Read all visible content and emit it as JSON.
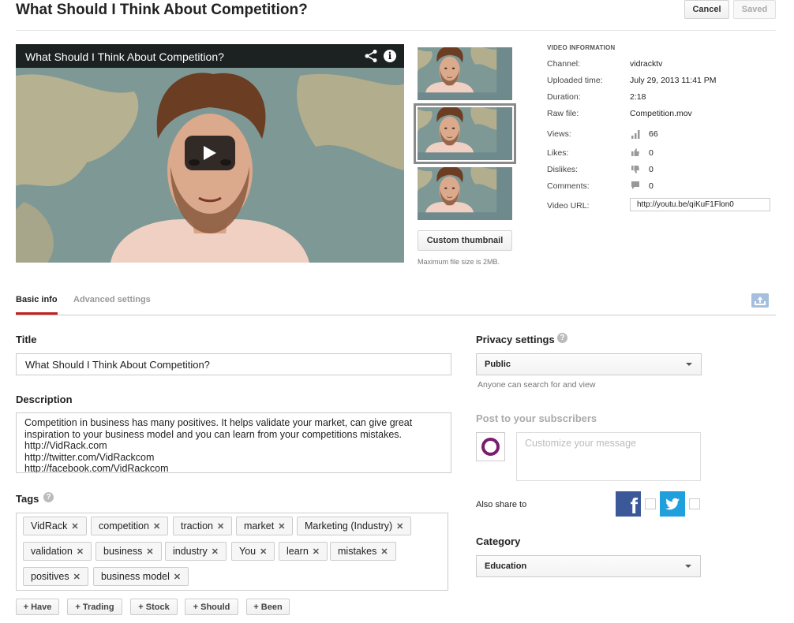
{
  "header": {
    "title": "What Should I Think About Competition?",
    "cancel_label": "Cancel",
    "saved_label": "Saved"
  },
  "player": {
    "title": "What Should I Think About Competition?",
    "icons": [
      "share-icon",
      "info-icon",
      "play-icon"
    ]
  },
  "thumbnails": {
    "selected_index": 1,
    "custom_label": "Custom thumbnail",
    "note": "Maximum file size is 2MB."
  },
  "video_info": {
    "heading": "VIDEO INFORMATION",
    "channel_label": "Channel:",
    "channel": "vidracktv",
    "uploaded_label": "Uploaded time:",
    "uploaded": "July 29, 2013 11:41 PM",
    "duration_label": "Duration:",
    "duration": "2:18",
    "raw_file_label": "Raw file:",
    "raw_file": "Competition.mov",
    "views_label": "Views:",
    "views": "66",
    "likes_label": "Likes:",
    "likes": "0",
    "dislikes_label": "Dislikes:",
    "dislikes": "0",
    "comments_label": "Comments:",
    "comments": "0",
    "url_label": "Video URL:",
    "url": "http://youtu.be/qiKuF1Flon0"
  },
  "tabs": {
    "basic": "Basic info",
    "advanced": "Advanced settings",
    "active": "basic"
  },
  "form": {
    "title_label": "Title",
    "title_value": "What Should I Think About Competition?",
    "description_label": "Description",
    "description_value": "Competition in business has many positives. It helps validate your market, can give great inspiration to your business model and you can learn from your competitions mistakes.\nhttp://VidRack.com\nhttp://twitter.com/VidRackcom\nhttp://facebook.com/VidRackcom",
    "tags_label": "Tags",
    "tags": [
      "VidRack",
      "competition",
      "traction",
      "market",
      "Marketing (Industry)",
      "validation",
      "business",
      "industry",
      "You",
      "learn",
      "mistakes",
      "positives",
      "business model"
    ],
    "suggestions": [
      "+ Have",
      "+ Trading",
      "+ Stock",
      "+ Should",
      "+ Been"
    ]
  },
  "privacy": {
    "label": "Privacy settings",
    "value": "Public",
    "hint": "Anyone can search for and view"
  },
  "post": {
    "label": "Post to your subscribers",
    "placeholder": "Customize your message",
    "also_share": "Also share to",
    "facebook_glyph": "f"
  },
  "category": {
    "label": "Category",
    "value": "Education"
  },
  "colors": {
    "accent_red": "#c0201e",
    "facebook": "#3b5998",
    "twitter": "#1f9fdb"
  }
}
